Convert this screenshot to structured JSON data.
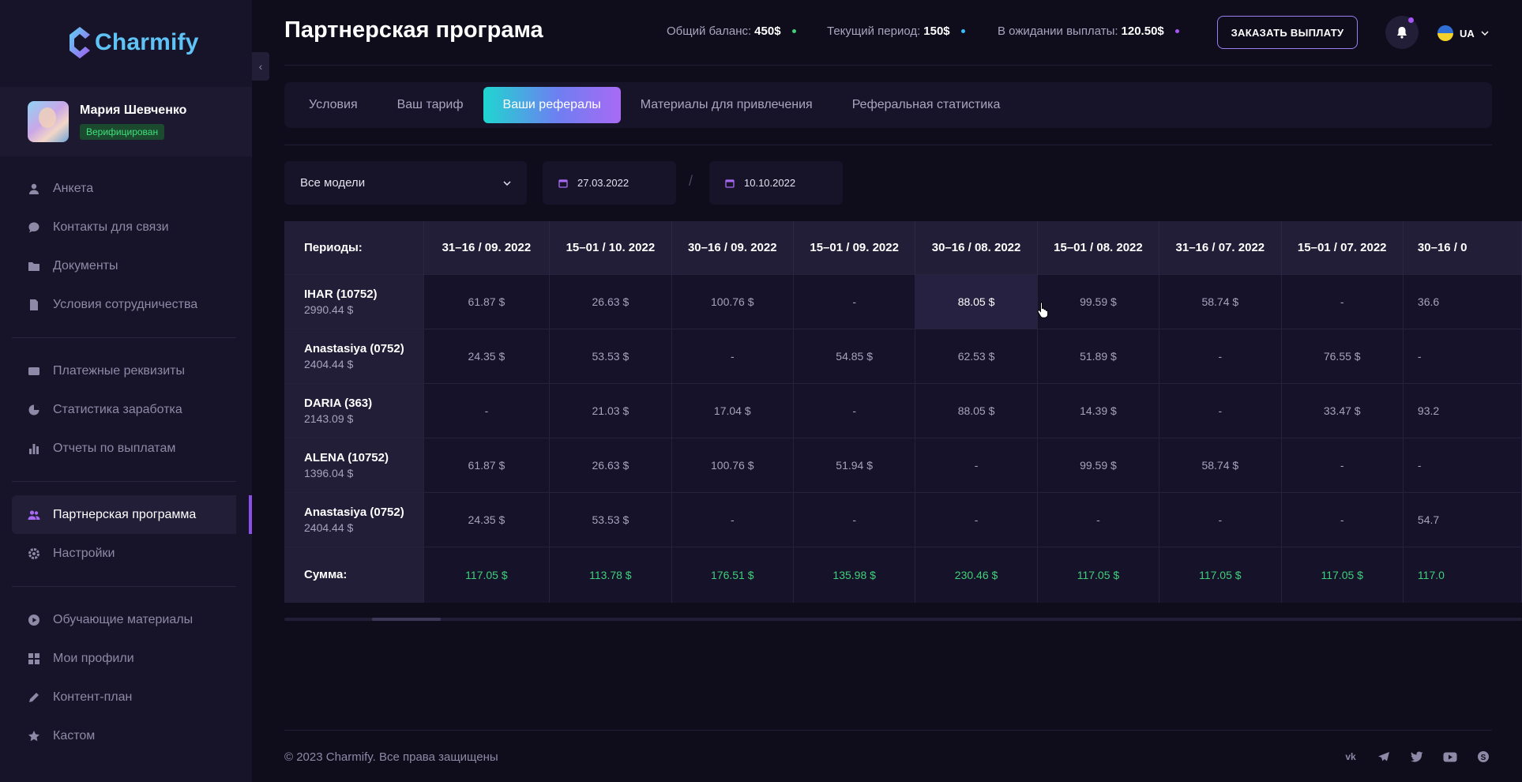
{
  "brand": {
    "name": "Charmify"
  },
  "profile": {
    "name": "Мария Шевченко",
    "badge": "Верифицирован"
  },
  "nav": {
    "group1": [
      {
        "label": "Анкета",
        "icon": "user-icon"
      },
      {
        "label": "Контакты для связи",
        "icon": "chat-icon"
      },
      {
        "label": "Документы",
        "icon": "folder-icon"
      },
      {
        "label": "Условия сотрудничества",
        "icon": "document-icon"
      }
    ],
    "group2": [
      {
        "label": "Платежные реквизиты",
        "icon": "card-icon"
      },
      {
        "label": "Статистика заработка",
        "icon": "pie-chart-icon"
      },
      {
        "label": "Отчеты по выплатам",
        "icon": "bar-chart-icon"
      }
    ],
    "group3": [
      {
        "label": "Партнерская программа",
        "icon": "users-icon",
        "active": true
      },
      {
        "label": "Настройки",
        "icon": "gear-icon"
      }
    ],
    "group4": [
      {
        "label": "Обучающие материалы",
        "icon": "play-icon"
      },
      {
        "label": "Мои профили",
        "icon": "grid-icon"
      },
      {
        "label": "Контент-план",
        "icon": "pencil-icon"
      },
      {
        "label": "Кастом",
        "icon": "star-icon"
      }
    ]
  },
  "header": {
    "title": "Партнерская програма",
    "balance_label": "Общий баланс:",
    "balance_value": "450$",
    "period_label": "Текущий период:",
    "period_value": "150$",
    "pending_label": "В ожидании выплаты:",
    "pending_value": "120.50$",
    "order_button": "ЗАКАЗАТЬ ВЫПЛАТУ",
    "lang": "UA",
    "colors": {
      "balance_dot": "#3fd07a",
      "period_dot": "#38bdf8",
      "pending_dot": "#a855f7"
    }
  },
  "tabs": [
    {
      "label": "Условия"
    },
    {
      "label": "Ваш тариф"
    },
    {
      "label": "Ваши рефералы",
      "active": true
    },
    {
      "label": "Материалы для привлечения"
    },
    {
      "label": "Реферальная статистика"
    }
  ],
  "filters": {
    "model_select": "Все модели",
    "date_from": "27.03.2022",
    "date_to": "10.10.2022",
    "separator": "/"
  },
  "table": {
    "periods_label": "Периоды:",
    "sum_label": "Сумма:",
    "columns": [
      "31–16 / 09. 2022",
      "15–01 / 10. 2022",
      "30–16 / 09. 2022",
      "15–01 / 09. 2022",
      "30–16 / 08. 2022",
      "15–01 / 08. 2022",
      "31–16 / 07. 2022",
      "15–01 / 07. 2022",
      "30–16 / 0"
    ],
    "rows": [
      {
        "name": "IHAR (10752)",
        "total": "2990.44 $",
        "values": [
          "61.87 $",
          "26.63 $",
          "100.76 $",
          "-",
          "88.05 $",
          "99.59 $",
          "58.74 $",
          "-",
          "36.6"
        ]
      },
      {
        "name": "Anastasiya (0752)",
        "total": "2404.44 $",
        "values": [
          "24.35 $",
          "53.53 $",
          "-",
          "54.85 $",
          "62.53 $",
          "51.89 $",
          "-",
          "76.55 $",
          "-"
        ]
      },
      {
        "name": "DARIA (363)",
        "total": "2143.09 $",
        "values": [
          "-",
          "21.03 $",
          "17.04 $",
          "-",
          "88.05 $",
          "14.39 $",
          "-",
          "33.47 $",
          "93.2"
        ]
      },
      {
        "name": "ALENA (10752)",
        "total": "1396.04 $",
        "values": [
          "61.87 $",
          "26.63 $",
          "100.76 $",
          "51.94 $",
          "-",
          "99.59 $",
          "58.74 $",
          "-",
          "-"
        ]
      },
      {
        "name": "Anastasiya (0752)",
        "total": "2404.44 $",
        "values": [
          "24.35 $",
          "53.53 $",
          "-",
          "-",
          "-",
          "-",
          "-",
          "-",
          "54.7"
        ]
      }
    ],
    "sums": [
      "117.05 $",
      "113.78 $",
      "176.51 $",
      "135.98 $",
      "230.46 $",
      "117.05 $",
      "117.05 $",
      "117.05 $",
      "117.0"
    ]
  },
  "footer": {
    "copyright": "© 2023 Charmify. Все права защищены",
    "socials": [
      "vk-icon",
      "telegram-icon",
      "twitter-icon",
      "youtube-icon",
      "skype-icon"
    ]
  }
}
